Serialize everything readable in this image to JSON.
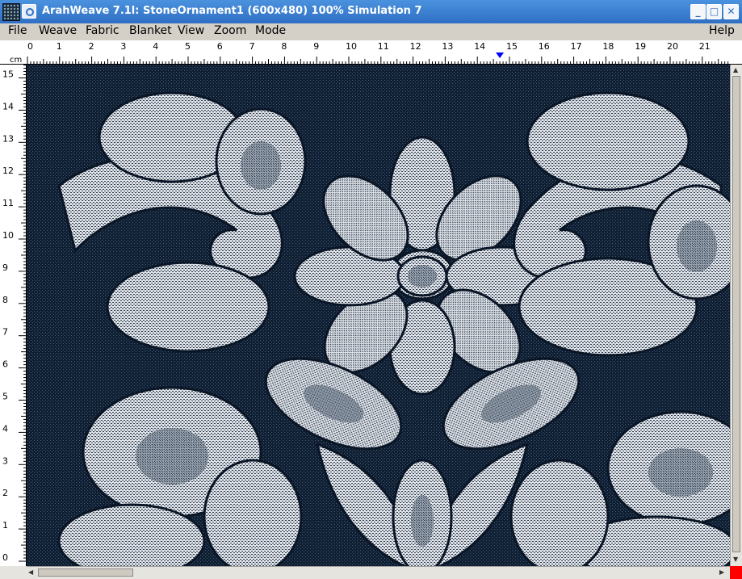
{
  "window": {
    "title": "ArahWeave 7.1l: StoneOrnament1 (600x480) 100% Simulation 7",
    "minimize_label": "_",
    "maximize_label": "□",
    "close_label": "✕"
  },
  "menu": {
    "left": [
      "File",
      "Weave",
      "Fabric",
      "Blanket",
      "View",
      "Zoom",
      "Mode"
    ],
    "help": "Help"
  },
  "ruler": {
    "unit": "cm",
    "top_labels": [
      "0",
      "1",
      "2",
      "3",
      "4",
      "5",
      "6",
      "7",
      "8",
      "9",
      "10",
      "11",
      "12",
      "13",
      "14",
      "15",
      "16",
      "17",
      "18",
      "19",
      "20",
      "21"
    ],
    "left_labels": [
      "15",
      "14",
      "13",
      "12",
      "11",
      "10",
      "9",
      "8",
      "7",
      "6",
      "5",
      "4",
      "3",
      "2",
      "1",
      "0"
    ],
    "marker_position_cm": 14.7
  },
  "canvas": {
    "background_color": "#0e1e33",
    "thread_color": "#dfe3e8"
  },
  "colors": {
    "titlebar": "#3a80d2",
    "menubar": "#d4d0c8",
    "indicator": "#ff0000",
    "marker": "#0000ff"
  },
  "icons": [
    "app-icon",
    "system-menu-icon",
    "minimize-icon",
    "maximize-icon",
    "close-icon",
    "ruler-marker-icon"
  ]
}
